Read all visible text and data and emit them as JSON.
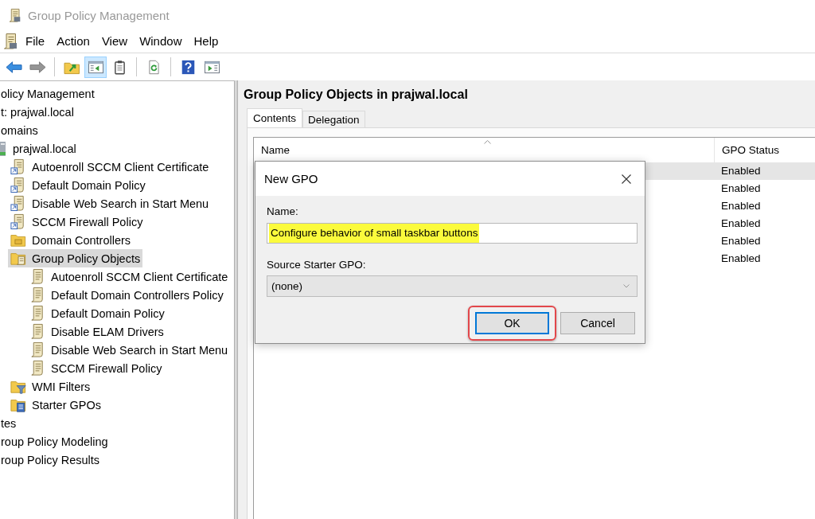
{
  "window": {
    "title": "Group Policy Management"
  },
  "menu": [
    "File",
    "Action",
    "View",
    "Window",
    "Help"
  ],
  "toolbar": [
    [
      {
        "kind": "back",
        "disabled": false,
        "pressed": false
      },
      {
        "kind": "forward",
        "disabled": true,
        "pressed": false
      }
    ],
    [
      {
        "kind": "up-folder",
        "disabled": false,
        "pressed": false
      },
      {
        "kind": "console-tree",
        "disabled": false,
        "pressed": true
      },
      {
        "kind": "properties",
        "disabled": false,
        "pressed": false
      }
    ],
    [
      {
        "kind": "refresh",
        "disabled": false,
        "pressed": false
      }
    ],
    [
      {
        "kind": "help",
        "disabled": false,
        "pressed": false
      },
      {
        "kind": "action-pane",
        "disabled": false,
        "pressed": false
      }
    ]
  ],
  "tree": {
    "items": [
      {
        "label": "olicy Management",
        "selected": false,
        "children": [
          {
            "label": "t: prajwal.local",
            "selected": false,
            "children": [
              {
                "label": "omains",
                "selected": false,
                "children": [
                  {
                    "label": "prajwal.local",
                    "kind": "domain",
                    "selected": false,
                    "children": [
                      {
                        "label": "Autoenroll SCCM Client Certificate",
                        "kind": "gpo-link",
                        "selected": false
                      },
                      {
                        "label": "Default Domain Policy",
                        "kind": "gpo-link",
                        "selected": false
                      },
                      {
                        "label": "Disable Web Search in Start Menu",
                        "kind": "gpo-link",
                        "selected": false
                      },
                      {
                        "label": "SCCM Firewall Policy",
                        "kind": "gpo-link",
                        "selected": false
                      },
                      {
                        "label": "Domain Controllers",
                        "kind": "ou-folder",
                        "selected": false
                      },
                      {
                        "label": "Group Policy Objects",
                        "kind": "gpo-folder",
                        "selected": true,
                        "children": [
                          {
                            "label": "Autoenroll SCCM Client Certificate",
                            "kind": "gpo",
                            "selected": false
                          },
                          {
                            "label": "Default Domain Controllers Policy",
                            "kind": "gpo",
                            "selected": false
                          },
                          {
                            "label": "Default Domain Policy",
                            "kind": "gpo",
                            "selected": false
                          },
                          {
                            "label": "Disable ELAM Drivers",
                            "kind": "gpo",
                            "selected": false
                          },
                          {
                            "label": "Disable Web Search in Start Menu",
                            "kind": "gpo",
                            "selected": false
                          },
                          {
                            "label": "SCCM Firewall Policy",
                            "kind": "gpo",
                            "selected": false
                          }
                        ]
                      },
                      {
                        "label": "WMI Filters",
                        "kind": "filter-folder",
                        "selected": false
                      },
                      {
                        "label": "Starter GPOs",
                        "kind": "starter-folder",
                        "selected": false
                      }
                    ]
                  }
                ]
              },
              {
                "label": "tes",
                "selected": false
              }
            ]
          },
          {
            "label": "roup Policy Modeling",
            "selected": false
          },
          {
            "label": "roup Policy Results",
            "selected": false
          }
        ]
      }
    ]
  },
  "right_pane": {
    "title": "Group Policy Objects in prajwal.local",
    "tabs": [
      {
        "label": "Contents",
        "selected": true
      },
      {
        "label": "Delegation",
        "selected": false
      }
    ],
    "table": {
      "columns": [
        {
          "label": "Name",
          "sorted": true
        },
        {
          "label": "GPO Status",
          "sorted": false
        }
      ],
      "rows": [
        {
          "gpo_status": "Enabled",
          "selected": true
        },
        {
          "gpo_status": "Enabled",
          "selected": false
        },
        {
          "gpo_status": "Enabled",
          "selected": false
        },
        {
          "gpo_status": "Enabled",
          "selected": false
        },
        {
          "gpo_status": "Enabled",
          "selected": false
        },
        {
          "gpo_status": "Enabled",
          "selected": false
        }
      ]
    }
  },
  "dialog": {
    "title": "New GPO",
    "name_label": "Name:",
    "name_value": "Configure behavior of small taskbar buttons",
    "name_highlighted": true,
    "source_label": "Source Starter GPO:",
    "source_value": "(none)",
    "buttons": [
      {
        "label": "OK",
        "default": true,
        "annotated": true
      },
      {
        "label": "Cancel",
        "default": false,
        "annotated": false
      }
    ]
  }
}
